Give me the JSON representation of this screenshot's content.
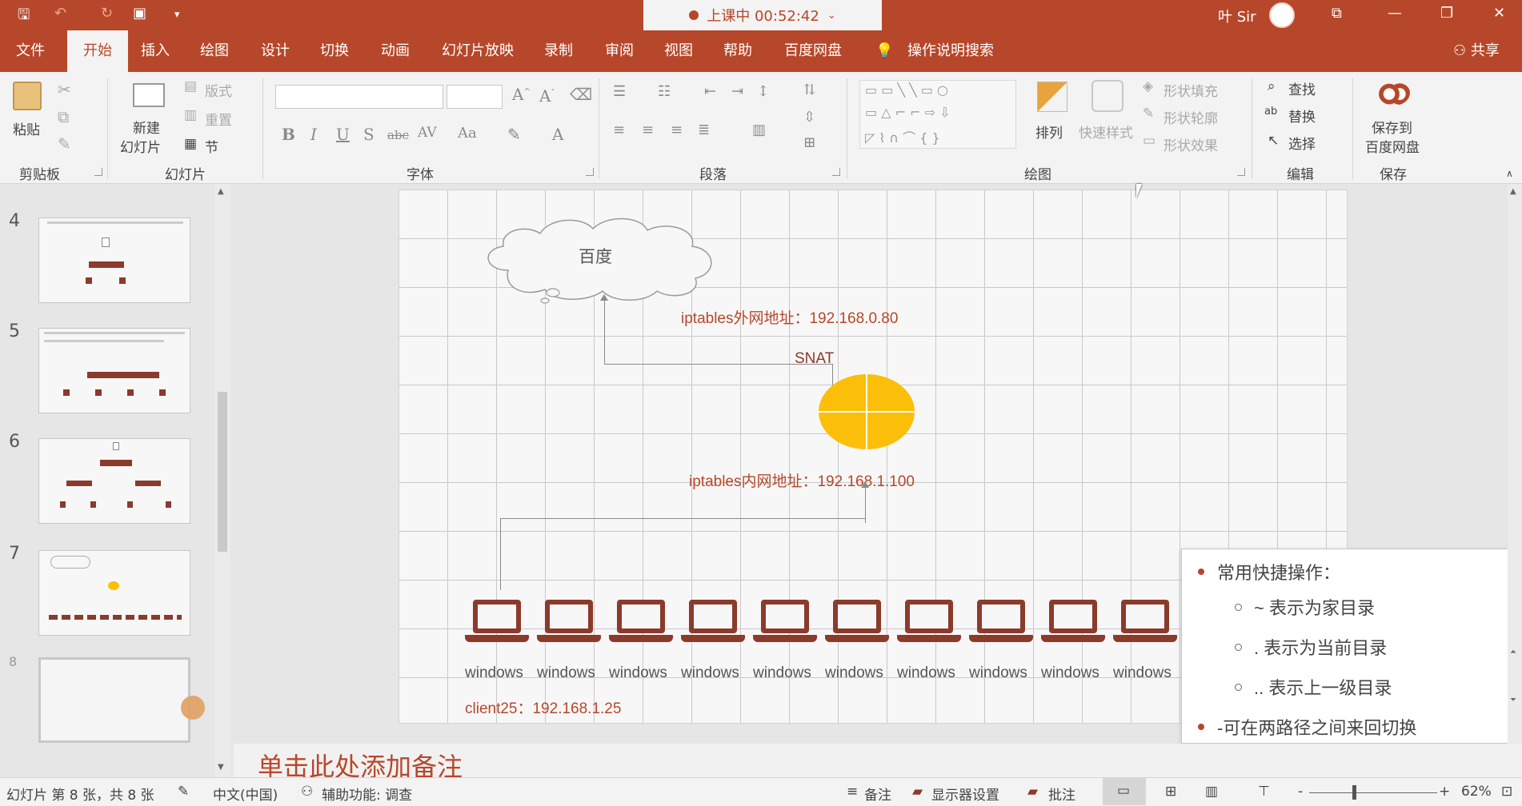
{
  "titlebar": {
    "recording": "上课中 00:52:42",
    "user": "叶 Sir",
    "icons": [
      "save-icon",
      "undo-icon",
      "redo-icon",
      "present-icon",
      "customize-icon"
    ]
  },
  "tabs": [
    "文件",
    "开始",
    "插入",
    "绘图",
    "设计",
    "切换",
    "动画",
    "幻灯片放映",
    "录制",
    "审阅",
    "视图",
    "帮助",
    "百度网盘"
  ],
  "search_label": "操作说明搜索",
  "share_label": "共享",
  "ribbon": {
    "clipboard": {
      "paste": "粘贴",
      "label": "剪贴板"
    },
    "slides": {
      "new_slide_line1": "新建",
      "new_slide_line2": "幻灯片",
      "layout": "版式",
      "reset": "重置",
      "section": "节",
      "label": "幻灯片"
    },
    "font": {
      "label": "字体",
      "bold": "B",
      "italic": "I",
      "underline": "U",
      "strike": "S",
      "abc": "abc",
      "spacing": "AV",
      "case": "Aa",
      "color": "A"
    },
    "paragraph": {
      "label": "段落"
    },
    "drawing": {
      "arrange": "排列",
      "quick_styles": "快速样式",
      "fill": "形状填充",
      "outline": "形状轮廓",
      "effects": "形状效果",
      "label": "绘图"
    },
    "editing": {
      "find": "查找",
      "replace": "替换",
      "select": "选择",
      "label": "编辑"
    },
    "save": {
      "line1": "保存到",
      "line2": "百度网盘",
      "label": "保存"
    }
  },
  "thumbnails": [
    "4",
    "5",
    "6",
    "7",
    "8"
  ],
  "slide": {
    "cloud_label": "百度",
    "wan_label": "iptables外网地址：192.168.0.80",
    "snat_label": "SNAT",
    "lan_label": "iptables内网地址：192.168.1.100",
    "laptop_labels": [
      "windows",
      "windows",
      "windows",
      "windows",
      "windows",
      "windows",
      "windows",
      "windows",
      "windows",
      "windows"
    ],
    "client_label": "client25：192.168.1.25",
    "accent": "#b7472a",
    "router_color": "#fbbf0a"
  },
  "popup": {
    "title": "常用快捷操作：",
    "items": [
      "~ 表示为家目录",
      ". 表示为当前目录",
      ".. 表示上一级目录"
    ],
    "footer": "-可在两路径之间来回切换"
  },
  "notes_placeholder": "单击此处添加备注",
  "status": {
    "slide_info": "幻灯片 第 8 张，共 8 张",
    "language": "中文(中国)",
    "accessibility": "辅助功能: 调查",
    "notes": "备注",
    "display": "显示器设置",
    "comments": "批注",
    "zoom": "62%",
    "minus": "-",
    "plus": "+"
  }
}
